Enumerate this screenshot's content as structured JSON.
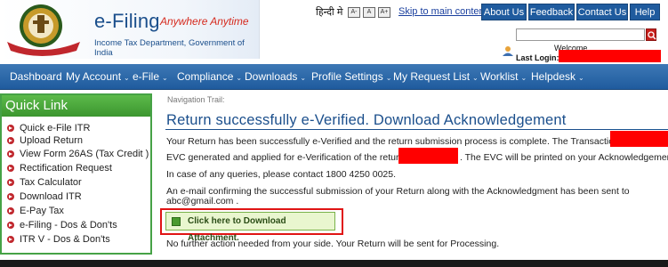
{
  "header": {
    "brand_name": "e-Filing",
    "brand_tagline": "Anywhere Anytime",
    "brand_sub": "Income Tax Department, Government of India",
    "lang_hindi": "हिन्दी मे",
    "font_buttons": [
      "A-",
      "A",
      "A+"
    ],
    "skip_link": "Skip to main content",
    "top_buttons": [
      "About Us",
      "Feedback",
      "Contact Us",
      "Help"
    ],
    "search_placeholder": "",
    "welcome": "Welcome",
    "last_login_label": "Last Login:"
  },
  "nav": {
    "items": [
      {
        "label": "Dashboard",
        "caret": false
      },
      {
        "label": "My Account",
        "caret": true
      },
      {
        "label": "e-File",
        "caret": true
      },
      {
        "label": "Compliance",
        "caret": true
      },
      {
        "label": "Downloads",
        "caret": true
      },
      {
        "label": "Profile Settings",
        "caret": true
      },
      {
        "label": "My Request List",
        "caret": true
      },
      {
        "label": "Worklist",
        "caret": true
      },
      {
        "label": "Helpdesk",
        "caret": true
      }
    ]
  },
  "sidebar": {
    "title": "Quick Link",
    "items": [
      "Quick e-File ITR",
      "Upload Return",
      "View Form 26AS (Tax Credit )",
      "Rectification Request",
      "Tax Calculator",
      "Download ITR",
      "E-Pay Tax",
      "e-Filing - Dos & Don'ts",
      "ITR V - Dos & Don'ts"
    ]
  },
  "main": {
    "nav_trail": "Navigation Trail:",
    "title": "Return successfully e-Verified. Download Acknowledgement",
    "para1": "Your Return has been successfully e-Verified and the return submission process is complete. The Transaction ID is",
    "para2a": "EVC generated and applied for e-Verification of the return is",
    "para2b": ". The EVC will be printed on your Acknowledgement.",
    "para3": "In case of any queries, please contact 1800 4250 0025.",
    "para4a": "An e-mail confirming the successful submission of your Return along with the Acknowledgment has been sent to",
    "para4b": "abc@gmail.com .",
    "download_button": "Click here to Download Attachment.",
    "para5": "No further action needed from your side. Your Return will be sent for Processing."
  },
  "colors": {
    "brand_blue": "#1b4f8c",
    "nav_blue": "#1f5b9e",
    "quicklink_green": "#46a246",
    "redaction": "#ff0000",
    "highlight_border": "#e01414"
  },
  "icons": {
    "emblem": "income-tax-emblem",
    "search": "search-icon",
    "user": "user-icon",
    "bullet": "arrow-bullet-icon",
    "download": "download-icon"
  }
}
